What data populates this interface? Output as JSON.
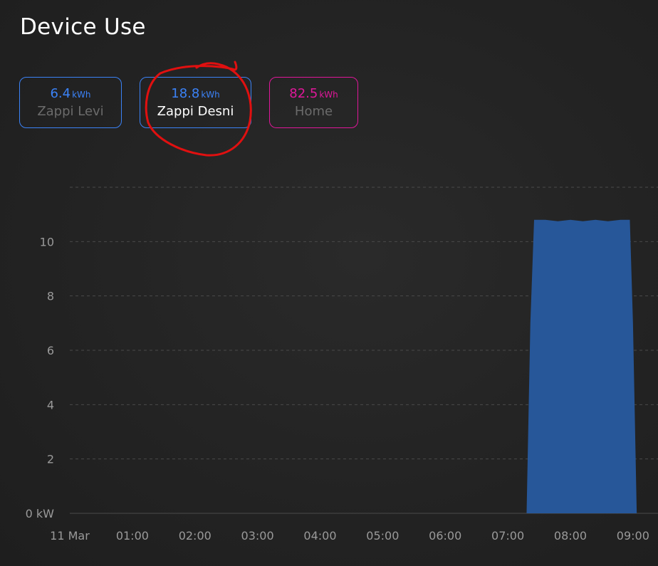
{
  "page": {
    "title": "Device Use"
  },
  "devices": [
    {
      "value": "6.4",
      "unit": "kWh",
      "name": "Zappi Levi",
      "color": "#3b82f6",
      "name_color": "#6b6b6b",
      "selected": false
    },
    {
      "value": "18.8",
      "unit": "kWh",
      "name": "Zappi Desni",
      "color": "#3b82f6",
      "name_color": "#ffffff",
      "selected": true
    },
    {
      "value": "82.5",
      "unit": "kWh",
      "name": "Home",
      "color": "#e0179a",
      "name_color": "#6b6b6b",
      "selected": false
    }
  ],
  "colors": {
    "series": "#275799",
    "annotation": "#e01010",
    "grid": "#4a4a4a",
    "tick": "#9a9a9a"
  },
  "chart_data": {
    "type": "area",
    "x_ticks": [
      "11 Mar",
      "01:00",
      "02:00",
      "03:00",
      "04:00",
      "05:00",
      "06:00",
      "07:00",
      "08:00",
      "09:00"
    ],
    "y_ticks": [
      "0 kW",
      "2",
      "4",
      "6",
      "8",
      "10"
    ],
    "ylim": [
      0,
      12
    ],
    "xlim_hours": [
      0,
      9.4
    ],
    "grid": true,
    "series": [
      {
        "x": [
          0,
          7.3,
          7.36,
          7.42,
          7.6,
          7.8,
          8.0,
          8.2,
          8.4,
          8.6,
          8.8,
          8.95,
          9.0,
          9.06,
          9.4
        ],
        "y": [
          0,
          0,
          7.0,
          10.8,
          10.8,
          10.75,
          10.8,
          10.75,
          10.8,
          10.75,
          10.8,
          10.8,
          7.0,
          0,
          0
        ]
      }
    ]
  }
}
